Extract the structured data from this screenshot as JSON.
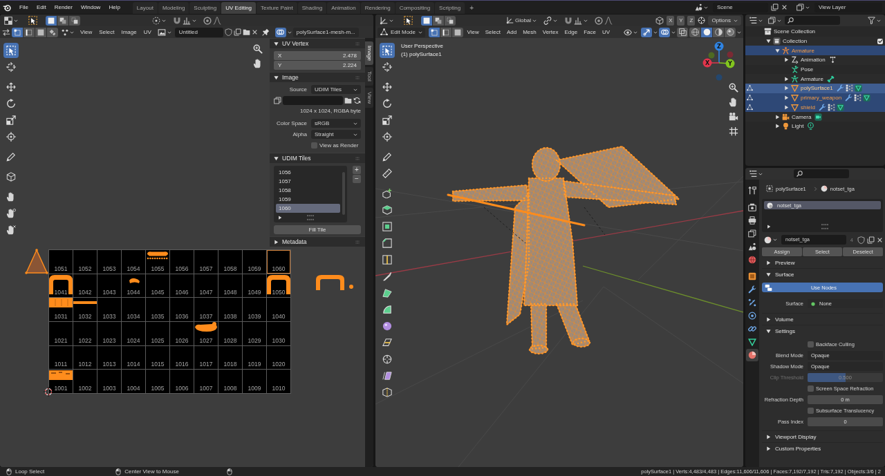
{
  "topbar": {
    "menus": [
      "File",
      "Edit",
      "Render",
      "Window",
      "Help"
    ],
    "workspaces": [
      {
        "label": "Layout",
        "selected": false
      },
      {
        "label": "Modeling",
        "selected": false
      },
      {
        "label": "Sculpting",
        "selected": false
      },
      {
        "label": "UV Editing",
        "selected": true
      },
      {
        "label": "Texture Paint",
        "selected": false
      },
      {
        "label": "Shading",
        "selected": false
      },
      {
        "label": "Animation",
        "selected": false
      },
      {
        "label": "Rendering",
        "selected": false
      },
      {
        "label": "Compositing",
        "selected": false
      },
      {
        "label": "Scripting",
        "selected": false
      }
    ],
    "add_workspace": "+",
    "scene": "Scene",
    "view_layer": "View Layer"
  },
  "uv_editor": {
    "box_modes": [
      {
        "selected": true
      },
      {
        "selected": false
      },
      {
        "selected": false
      }
    ],
    "select_modes": [
      {
        "selected": true
      },
      {
        "selected": false
      },
      {
        "selected": false
      },
      {
        "selected": false
      }
    ],
    "menus": [
      "View",
      "Select",
      "Image",
      "UV"
    ],
    "image_name": "Untitled",
    "overlays_on": true,
    "uv_map": "polySurface1-mesh-m...",
    "tools": [
      {
        "selected": true
      },
      {
        "selected": false
      },
      {
        "selected": false
      },
      {
        "selected": false
      },
      {
        "selected": false
      },
      {
        "selected": false
      },
      {
        "selected": false
      },
      {
        "selected": false
      },
      {
        "selected": false
      },
      {
        "selected": false
      },
      {
        "selected": false
      }
    ],
    "tiles": [
      [
        {
          "label": "1051",
          "selected": false
        },
        {
          "label": "1052",
          "selected": false
        },
        {
          "label": "1053",
          "selected": false
        },
        {
          "label": "1054",
          "selected": false
        },
        {
          "label": "1055",
          "selected": false
        },
        {
          "label": "1056",
          "selected": false
        },
        {
          "label": "1057",
          "selected": false
        },
        {
          "label": "1058",
          "selected": false
        },
        {
          "label": "1059",
          "selected": false
        },
        {
          "label": "1060",
          "selected": true
        }
      ],
      [
        {
          "label": "1041",
          "selected": false
        },
        {
          "label": "1042",
          "selected": false
        },
        {
          "label": "1043",
          "selected": false
        },
        {
          "label": "1044",
          "selected": false
        },
        {
          "label": "1045",
          "selected": false
        },
        {
          "label": "1046",
          "selected": false
        },
        {
          "label": "1047",
          "selected": false
        },
        {
          "label": "1048",
          "selected": false
        },
        {
          "label": "1049",
          "selected": false
        },
        {
          "label": "1050",
          "selected": false
        }
      ],
      [
        {
          "label": "1031",
          "selected": false
        },
        {
          "label": "1032",
          "selected": false
        },
        {
          "label": "1033",
          "selected": false
        },
        {
          "label": "1034",
          "selected": false
        },
        {
          "label": "1035",
          "selected": false
        },
        {
          "label": "1036",
          "selected": false
        },
        {
          "label": "1037",
          "selected": false
        },
        {
          "label": "1038",
          "selected": false
        },
        {
          "label": "1039",
          "selected": false
        },
        {
          "label": "1040",
          "selected": false
        }
      ],
      [
        {
          "label": "1021",
          "selected": false
        },
        {
          "label": "1022",
          "selected": false
        },
        {
          "label": "1023",
          "selected": false
        },
        {
          "label": "1024",
          "selected": false
        },
        {
          "label": "1025",
          "selected": false
        },
        {
          "label": "1026",
          "selected": false
        },
        {
          "label": "1027",
          "selected": false
        },
        {
          "label": "1028",
          "selected": false
        },
        {
          "label": "1029",
          "selected": false
        },
        {
          "label": "1030",
          "selected": false
        }
      ],
      [
        {
          "label": "1011",
          "selected": false
        },
        {
          "label": "1012",
          "selected": false
        },
        {
          "label": "1013",
          "selected": false
        },
        {
          "label": "1014",
          "selected": false
        },
        {
          "label": "1015",
          "selected": false
        },
        {
          "label": "1016",
          "selected": false
        },
        {
          "label": "1017",
          "selected": false
        },
        {
          "label": "1018",
          "selected": false
        },
        {
          "label": "1019",
          "selected": false
        },
        {
          "label": "1020",
          "selected": false
        }
      ],
      [
        {
          "label": "1001",
          "selected": false
        },
        {
          "label": "1002",
          "selected": false
        },
        {
          "label": "1003",
          "selected": false
        },
        {
          "label": "1004",
          "selected": false
        },
        {
          "label": "1005",
          "selected": false
        },
        {
          "label": "1006",
          "selected": false
        },
        {
          "label": "1007",
          "selected": false
        },
        {
          "label": "1008",
          "selected": false
        },
        {
          "label": "1009",
          "selected": false
        },
        {
          "label": "1010",
          "selected": false
        }
      ]
    ],
    "sidebar": {
      "uv_vertex": {
        "title": "UV Vertex",
        "expanded": true,
        "fields": [
          {
            "label": "X",
            "value": "2.478"
          },
          {
            "label": "Y",
            "value": "2.224"
          }
        ]
      },
      "image": {
        "title": "Image",
        "expanded": true,
        "rows": [
          {
            "kind": "dropdown",
            "label": "Source",
            "value": "UDIM Tiles"
          },
          {
            "kind": "file"
          },
          {
            "kind": "info",
            "text": "1024 x 1024, RGBA byte"
          },
          {
            "kind": "dropdown",
            "label": "Color Space",
            "value": "sRGB"
          },
          {
            "kind": "dropdown",
            "label": "Alpha",
            "value": "Straight"
          },
          {
            "kind": "checkbox",
            "label": "View as Render",
            "checked": false
          }
        ]
      },
      "udim": {
        "title": "UDIM Tiles",
        "expanded": true,
        "tiles": [
          {
            "label": "1056",
            "selected": false
          },
          {
            "label": "1057",
            "selected": false
          },
          {
            "label": "1058",
            "selected": false
          },
          {
            "label": "1059",
            "selected": false
          },
          {
            "label": "1060",
            "selected": true
          }
        ],
        "add": "+",
        "remove": "−",
        "fill": "Fill Tile"
      },
      "metadata": {
        "title": "Metadata",
        "expanded": false
      }
    },
    "sidebar_tabs": [
      {
        "label": "Image",
        "selected": true
      },
      {
        "label": "Tool",
        "selected": false
      },
      {
        "label": "View",
        "selected": false
      }
    ]
  },
  "viewport": {
    "box_modes": [
      {
        "selected": true
      },
      {
        "selected": false
      },
      {
        "selected": false
      }
    ],
    "orientation": "Global",
    "axis_buttons": [
      "X",
      "Y",
      "Z"
    ],
    "options": "Options",
    "mode": "Edit Mode",
    "select_modes": [
      {
        "selected": true
      },
      {
        "selected": false
      },
      {
        "selected": false
      }
    ],
    "menus": [
      "View",
      "Select",
      "Add",
      "Mesh",
      "Vertex",
      "Edge",
      "Face",
      "UV"
    ],
    "gizmos_on": true,
    "overlays_on": true,
    "xray_on": false,
    "shading": [
      {
        "selected": false
      },
      {
        "selected": true
      },
      {
        "selected": false
      },
      {
        "selected": false
      }
    ],
    "view_name": "User Perspective",
    "object_name": "(1) polySurface1",
    "gizmo": [
      {
        "label": "Z",
        "color": "#2f84e3"
      },
      {
        "label": "X",
        "color": "#e2354c"
      },
      {
        "label": "Y",
        "color": "#82c51f"
      }
    ],
    "tools": [
      {
        "selected": true
      },
      {
        "selected": false
      },
      {
        "selected": false
      },
      {
        "selected": false
      },
      {
        "selected": false
      },
      {
        "selected": false
      },
      {
        "selected": false
      },
      {
        "selected": false
      },
      {
        "selected": false
      },
      {
        "selected": false
      },
      {
        "selected": false
      },
      {
        "selected": false
      },
      {
        "selected": false
      },
      {
        "selected": false
      },
      {
        "selected": false
      },
      {
        "selected": false
      },
      {
        "selected": false
      },
      {
        "selected": false
      },
      {
        "selected": false
      },
      {
        "selected": false
      },
      {
        "selected": false
      }
    ]
  },
  "outliner": {
    "tree": [
      {
        "label": "Scene Collection",
        "kind": "scene_collection",
        "selected": false,
        "active": false,
        "edit_mode": false,
        "children": [
          {
            "label": "Collection",
            "kind": "collection",
            "expanded": true,
            "checked": true,
            "selected": false,
            "active": false,
            "edit_mode": false,
            "children": [
              {
                "label": "Armature",
                "kind": "armature",
                "expanded": true,
                "selected": true,
                "active": false,
                "edit_mode": false,
                "children": [
                  {
                    "label": "Animation",
                    "kind": "action",
                    "expanded": false,
                    "selected": false,
                    "active": false,
                    "edit_mode": false
                  },
                  {
                    "label": "Pose",
                    "kind": "pose",
                    "selected": false,
                    "active": false,
                    "edit_mode": false
                  },
                  {
                    "label": "Armature",
                    "kind": "armature_data",
                    "expanded": false,
                    "selected": false,
                    "active": false,
                    "edit_mode": false
                  },
                  {
                    "label": "polySurface1",
                    "kind": "mesh",
                    "expanded": false,
                    "selected": true,
                    "active": true,
                    "edit_mode": true
                  },
                  {
                    "label": "primary_weapon",
                    "kind": "mesh",
                    "expanded": false,
                    "selected": true,
                    "active": false,
                    "edit_mode": true
                  },
                  {
                    "label": "shield",
                    "kind": "mesh",
                    "expanded": false,
                    "selected": true,
                    "active": false,
                    "edit_mode": true
                  }
                ]
              },
              {
                "label": "Camera",
                "kind": "camera",
                "expanded": false,
                "selected": false,
                "active": false,
                "edit_mode": false
              },
              {
                "label": "Light",
                "kind": "light",
                "expanded": false,
                "selected": false,
                "active": false,
                "edit_mode": false
              }
            ]
          }
        ]
      }
    ]
  },
  "properties": {
    "tabs": [
      {
        "selected": false
      },
      {
        "selected": false
      },
      {
        "selected": false
      },
      {
        "selected": false
      },
      {
        "selected": false
      },
      {
        "selected": false
      },
      {
        "selected": false
      },
      {
        "selected": false
      },
      {
        "selected": false
      },
      {
        "selected": false
      },
      {
        "selected": false
      },
      {
        "selected": false
      },
      {
        "selected": true
      }
    ],
    "breadcrumb": [
      "polySurface1",
      "notset_tga"
    ],
    "slots": [
      {
        "label": "notset_tga",
        "selected": true
      }
    ],
    "material": {
      "name": "notset_tga",
      "users": "4"
    },
    "slot_buttons": [
      "Assign",
      "Select",
      "Deselect"
    ],
    "panels": [
      {
        "title": "Preview",
        "expanded": false
      },
      {
        "title": "Surface",
        "expanded": true,
        "use_nodes": {
          "label": "Use Nodes",
          "on": true
        },
        "surface": {
          "label": "Surface",
          "value": "None"
        }
      },
      {
        "title": "Volume",
        "expanded": false
      },
      {
        "title": "Settings",
        "expanded": true,
        "rows": [
          {
            "kind": "checkbox",
            "label": "Backface Culling",
            "checked": false
          },
          {
            "kind": "dropdown",
            "label": "Blend Mode",
            "value": "Opaque"
          },
          {
            "kind": "dropdown",
            "label": "Shadow Mode",
            "value": "Opaque"
          },
          {
            "kind": "slider",
            "label": "Clip Threshold",
            "value": "0.500",
            "level": 0.5,
            "disabled": true
          },
          {
            "kind": "checkbox",
            "label": "Screen Space Refraction",
            "checked": false
          },
          {
            "kind": "number",
            "label": "Refraction Depth",
            "value": "0 m"
          },
          {
            "kind": "checkbox",
            "label": "Subsurface Translucency",
            "checked": false
          },
          {
            "kind": "number",
            "label": "Pass Index",
            "value": "0"
          }
        ]
      },
      {
        "title": "Viewport Display",
        "expanded": false
      },
      {
        "title": "Custom Properties",
        "expanded": false
      }
    ]
  },
  "status_bar": {
    "hints": [
      "Loop Select",
      "Center View to Mouse"
    ],
    "stats": "polySurface1 | Verts:4,483/4,483 | Edges:11,606/11,606 | Faces:7,192/7,192 | Tris:7,192 | Objects:3/6 | 2"
  }
}
